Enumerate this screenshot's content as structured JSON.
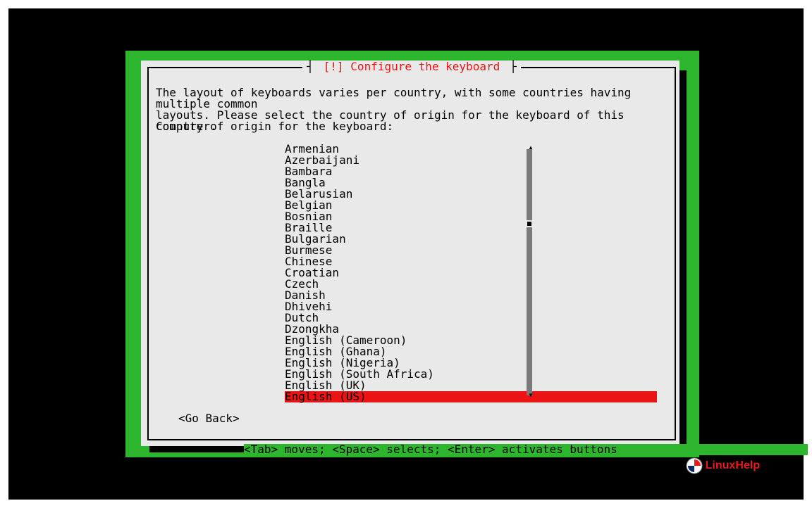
{
  "screen": {
    "title_left_bracket": "┤",
    "title_right_bracket": "├",
    "title": "[!] Configure the keyboard",
    "body": "The layout of keyboards varies per country, with some countries having multiple common\nlayouts. Please select the country of origin for the keyboard of this computer.",
    "prompt": "Country of origin for the keyboard:",
    "go_back": "<Go Back>",
    "help_bar": "<Tab> moves; <Space> selects; <Enter> activates buttons"
  },
  "list": {
    "selected_index": 22,
    "items": [
      "Armenian",
      "Azerbaijani",
      "Bambara",
      "Bangla",
      "Belarusian",
      "Belgian",
      "Bosnian",
      "Braille",
      "Bulgarian",
      "Burmese",
      "Chinese",
      "Croatian",
      "Czech",
      "Danish",
      "Dhivehi",
      "Dutch",
      "Dzongkha",
      "English (Cameroon)",
      "English (Ghana)",
      "English (Nigeria)",
      "English (South Africa)",
      "English (UK)",
      "English (US)"
    ]
  },
  "watermark": {
    "text": "LinuxHelp"
  }
}
